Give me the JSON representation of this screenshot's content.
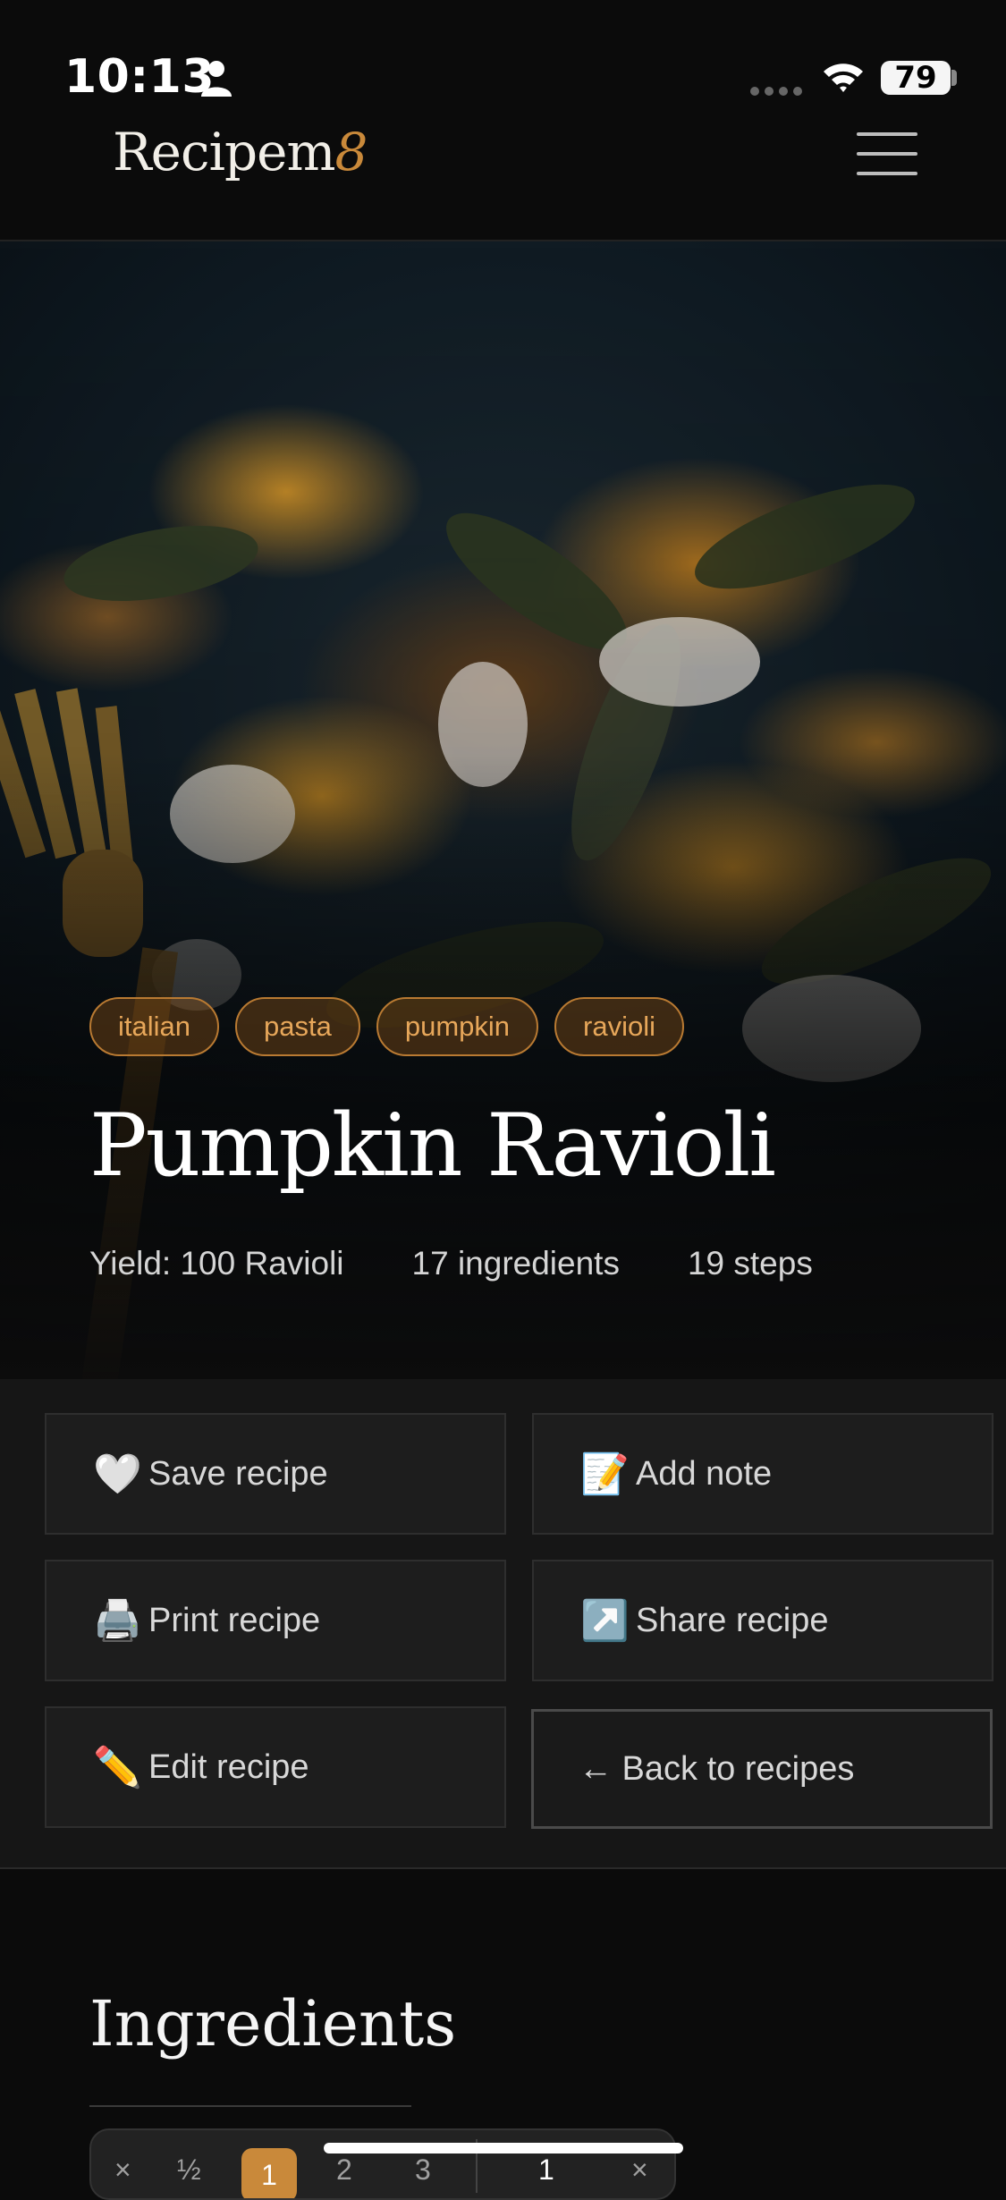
{
  "status_bar": {
    "time": "10:13",
    "battery": "79"
  },
  "header": {
    "brand_main": "Recipem",
    "brand_accent": "8"
  },
  "recipe": {
    "tags": [
      "italian",
      "pasta",
      "pumpkin",
      "ravioli"
    ],
    "title": "Pumpkin Ravioli",
    "meta": {
      "yield": "Yield: 100 Ravioli",
      "ingredients": "17 ingredients",
      "steps": "19 steps"
    }
  },
  "actions": {
    "save": {
      "icon": "🤍",
      "label": "Save recipe"
    },
    "note": {
      "icon": "📝",
      "label": "Add note"
    },
    "print": {
      "icon": "🖨️",
      "label": "Print recipe"
    },
    "share": {
      "icon": "↗️",
      "label": "Share recipe"
    },
    "edit": {
      "icon": "✏️",
      "label": "Edit recipe"
    },
    "back": {
      "label": "← Back to recipes"
    }
  },
  "ingredients": {
    "title": "Ingredients",
    "scale_options": [
      "×",
      "½",
      "1",
      "2",
      "3",
      "1",
      "×"
    ],
    "selected_scale": "1"
  },
  "colors": {
    "accent": "#c9893a",
    "background": "#0b0b0b",
    "panel": "#161616",
    "button": "#1d1d1d"
  }
}
